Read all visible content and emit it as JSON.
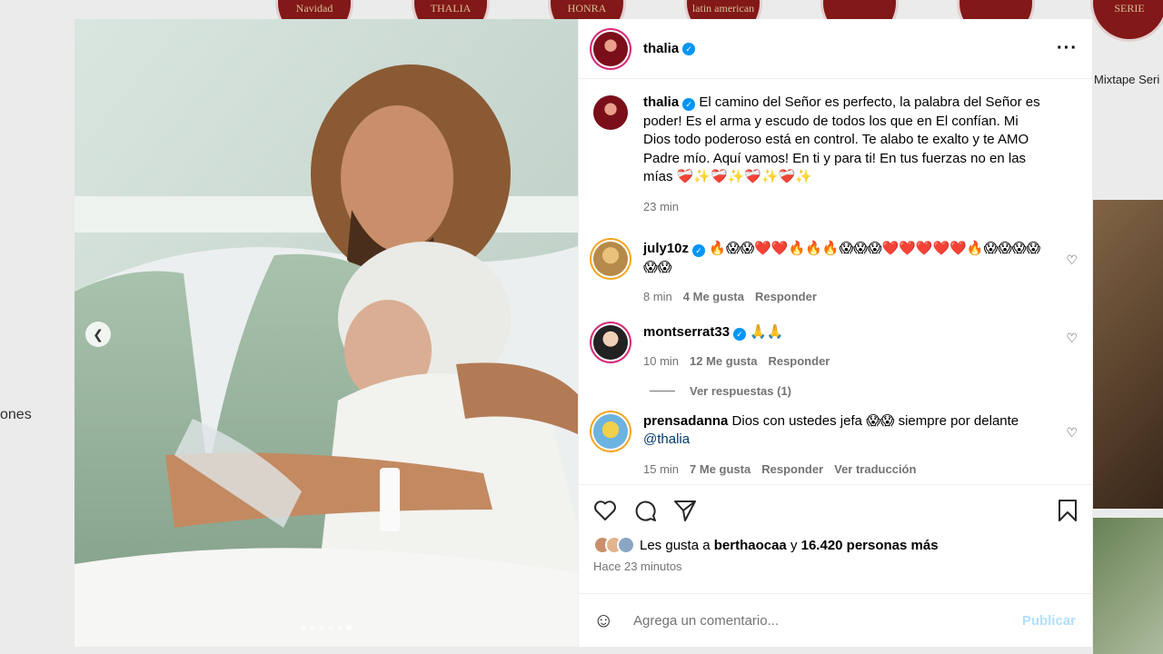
{
  "background": {
    "highlights": [
      "Navidad",
      "THALIA",
      "A MUCHA HONRA",
      "latin american",
      "",
      "",
      "SERIE"
    ],
    "highlight_label": "Mixtape Seri",
    "side_text": "ones"
  },
  "post": {
    "username": "thalia",
    "verified": true,
    "media": {
      "slide_count": 6,
      "active_slide": 6
    },
    "caption": {
      "username": "thalia",
      "text": "El camino del Señor es perfecto, la palabra del Señor es poder! Es el arma y escudo de todos los que en El confían. Mi Dios todo poderoso está en control. Te alabo te exalto y te AMO Padre mío. Aquí vamos! En ti y para ti! En tus fuerzas no en las mías ❤️‍🩹✨❤️‍🩹✨❤️‍🩹✨❤️‍🩹✨",
      "time": "23 min"
    },
    "comments": [
      {
        "username": "july10z",
        "verified": true,
        "text": "🔥😱😱❤️❤️🔥🔥🔥😱😱😱❤️❤️❤️❤️❤️🔥😱😱😱😱😱😱",
        "time": "8 min",
        "likes": "4 Me gusta",
        "reply": "Responder"
      },
      {
        "username": "montserrat33",
        "verified": true,
        "text": "🙏🙏",
        "time": "10 min",
        "likes": "12 Me gusta",
        "reply": "Responder",
        "view_replies": "Ver respuestas (1)"
      },
      {
        "username": "prensadanna",
        "verified": false,
        "text": "Dios con ustedes jefa 😱😱 siempre por delante",
        "mention": "@thalia",
        "time": "15 min",
        "likes": "7 Me gusta",
        "reply": "Responder",
        "translate": "Ver traducción"
      }
    ],
    "likes_text_prefix": "Les gusta a",
    "likes_user": "berthaocaa",
    "likes_conjunction": "y",
    "likes_count": "16.420 personas más",
    "posted": "Hace 23 minutos",
    "comment_placeholder": "Agrega un comentario...",
    "publish_label": "Publicar"
  },
  "colors": {
    "verified": "#0095f6",
    "publish_disabled": "#b2dffc",
    "link": "#00376b",
    "secondary_text": "#737373"
  },
  "icons": [
    "chevron-left-icon",
    "more-icon",
    "heart-icon",
    "comment-icon",
    "share-icon",
    "bookmark-icon",
    "emoji-icon",
    "verified-icon"
  ]
}
